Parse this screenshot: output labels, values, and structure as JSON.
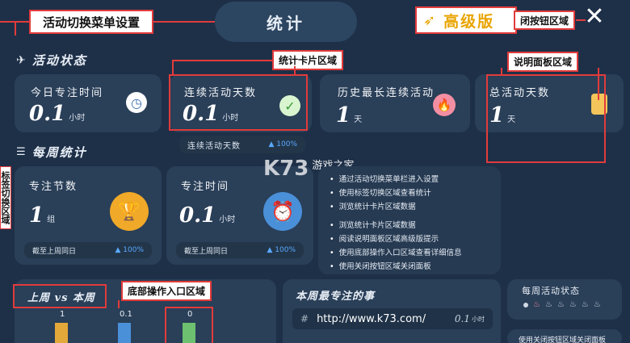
{
  "header": {
    "title": "统计",
    "menu_tag": "活动切换菜单设置",
    "premium_label": "高级版",
    "close_tag": "闭按钮区域",
    "close_glyph": "✕"
  },
  "sections": {
    "activity_title": "活动状态",
    "weekly_title": "每周统计"
  },
  "annotations": {
    "stat_cards": "统计卡片区域",
    "info_panel": "说明面板区域",
    "tab_switch": "标签切换区域",
    "bottom_action": "底部操作入口区域"
  },
  "activity_cards": [
    {
      "label": "今日专注时间",
      "value": "0.1",
      "unit": "小时",
      "icon": "clock-icon"
    },
    {
      "label": "连续活动天数",
      "value": "0.1",
      "unit": "小时",
      "icon": "check-icon"
    },
    {
      "label": "历史最长连续活动",
      "value": "1",
      "unit": "天",
      "icon": "flame-icon"
    },
    {
      "label": "总活动天数",
      "value": "1",
      "unit": "天",
      "icon": "note-icon"
    }
  ],
  "streak_pill": {
    "label": "连续活动天数",
    "change": "▲ 100%"
  },
  "weekly_cards": [
    {
      "label": "专注节数",
      "value": "1",
      "unit": "组",
      "icon": "trophy-icon",
      "footer": "截至上周同日",
      "change": "▲ 100%"
    },
    {
      "label": "专注时间",
      "value": "0.1",
      "unit": "小时",
      "icon": "alarm-icon",
      "footer": "截至上周同日",
      "change": "▲ 100%"
    }
  ],
  "watermark": {
    "logo": "K73",
    "name": "游戏之家"
  },
  "tips": [
    "通过活动切换菜单栏进入设置",
    "使用标签切换区域查看统计",
    "浏览统计卡片区域数据",
    "浏览统计卡片区域数据",
    "阅读说明面板区域高级版提示",
    "使用底部操作入口区域查看详细信息",
    "使用关闭按钮区域关闭面板"
  ],
  "compare": {
    "title": "上周 vs 本周",
    "bars": [
      {
        "label": "1",
        "color": "#e3a83a"
      },
      {
        "label": "0.1",
        "color": "#4a90d9"
      },
      {
        "label": "0",
        "color": "#6cc070"
      }
    ]
  },
  "focus_event": {
    "title": "本周最专注的事",
    "hash": "#",
    "url": "http://www.k73.com/",
    "value": "0.1",
    "unit": "小时"
  },
  "weekly_status": {
    "title": "每周活动状态",
    "footer": "使用关闭按钮区域关闭面板"
  },
  "colors": {
    "background": "#1e3048",
    "card": "#2a3f58",
    "annotation": "#e23b3b",
    "accent": "#5aa9ff"
  }
}
